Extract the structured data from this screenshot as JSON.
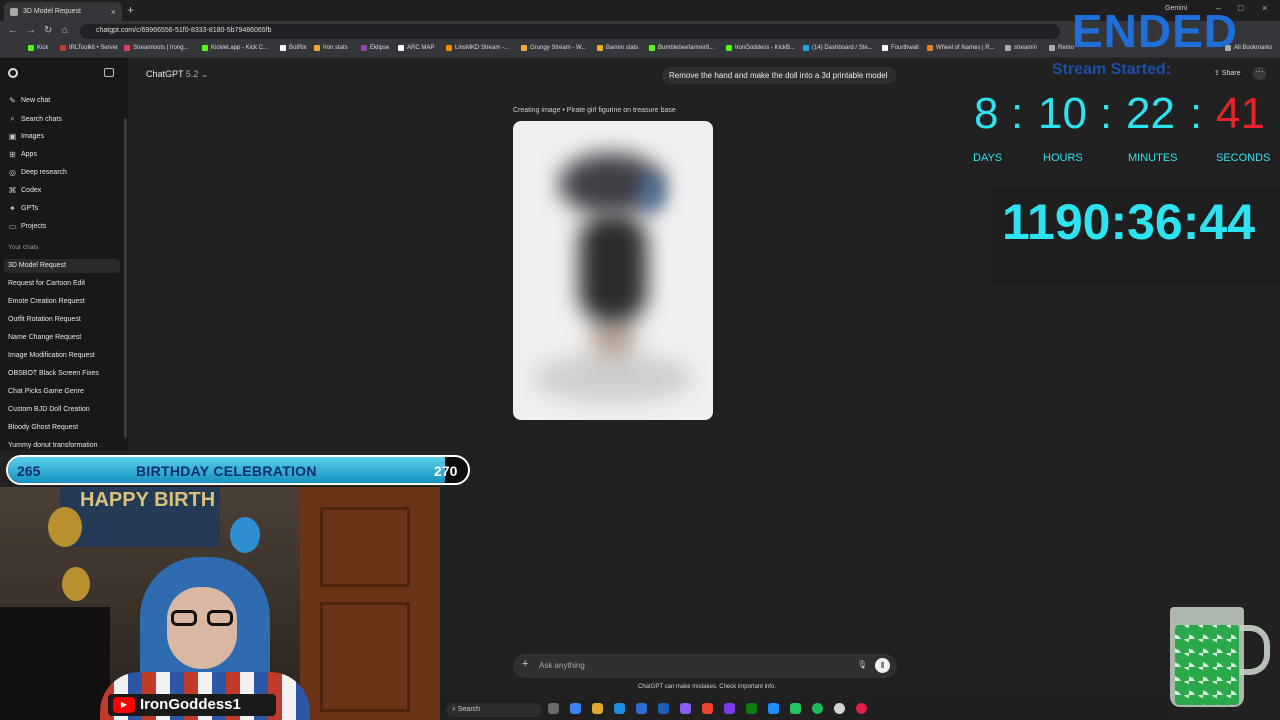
{
  "browser": {
    "tab_title": "3D Model Request",
    "new_tab": "+",
    "gemini": "Gemini",
    "url": "chatgpt.com/c/69966556-51f0-8333-8180-5b79486065fb",
    "bookmarks": [
      "Kick",
      "IRLToolkit • Server",
      "Streamloots | Irong...",
      "Kicklet.app - Kick C...",
      "BotRix",
      "Iron stats",
      "Eklipse",
      "ARC MAP",
      "LinsMKD Stream -...",
      "Grungy Stream - W...",
      "Barren stats",
      "Bumblebeefarmer8...",
      "IronGoddess - KickB...",
      "(14) Dashboard / Ste...",
      "Fourthwall",
      "Wheel of Names | R...",
      "streamin",
      "Remo",
      "All Bookmarks"
    ]
  },
  "sidebar": {
    "nav": [
      {
        "label": "New chat",
        "icon": "new-chat-icon",
        "glyph": "✎"
      },
      {
        "label": "Search chats",
        "icon": "search-icon",
        "glyph": "⌕"
      },
      {
        "label": "Images",
        "icon": "images-icon",
        "glyph": "▣"
      },
      {
        "label": "Apps",
        "icon": "apps-icon",
        "glyph": "⊞"
      },
      {
        "label": "Deep research",
        "icon": "deep-research-icon",
        "glyph": "◎"
      },
      {
        "label": "Codex",
        "icon": "codex-icon",
        "glyph": "⌘"
      },
      {
        "label": "GPTs",
        "icon": "gpts-icon",
        "glyph": "✦"
      },
      {
        "label": "Projects",
        "icon": "projects-icon",
        "glyph": "▭"
      }
    ],
    "your_chats_label": "Your chats",
    "chats": [
      "3D Model Request",
      "Request for Cartoon Edit",
      "Emote Creation Request",
      "Outfit Rotation Request",
      "Name Change Request",
      "Image Modification Request",
      "OBSBOT Black Screen Fixes",
      "Chat Picks Game Genre",
      "Custom BJD Doll Creation",
      "Bloody Ghost Request",
      "Yummy donut transformation"
    ]
  },
  "header": {
    "model": "ChatGPT",
    "version": "5.2",
    "share_label": "Share"
  },
  "conversation": {
    "user_message": "Remove the hand and make the doll into a 3d printable model",
    "creating_label": "Creating image • Pirate girl figurine on treasure base"
  },
  "composer": {
    "placeholder": "Ask anything",
    "disclaimer": "ChatGPT can make mistakes. Check important info."
  },
  "overlay": {
    "ended": "ENDED",
    "stream_started": "Stream Started:",
    "countdown": {
      "days": "8",
      "hours": "10",
      "minutes": "22",
      "seconds": "41",
      "days_label": "DAYS",
      "hours_label": "HOURS",
      "minutes_label": "MINUTES",
      "seconds_label": "SECONDS",
      "sep": ":"
    },
    "elapsed": "1190:36:44",
    "goal": {
      "start": "265",
      "title": "BIRTHDAY CELEBRATION",
      "end": "270",
      "progress": 0.95
    },
    "webcam_banner": "HAPPY BIRTH",
    "channel": "IronGoddess1"
  },
  "taskbar": {
    "search": "Search"
  },
  "colors": {
    "accent_cyan": "#2ee3f0",
    "ended_blue": "#1e6fd9",
    "seconds_red": "#e8222a",
    "goal_blue": "#1690bf"
  }
}
